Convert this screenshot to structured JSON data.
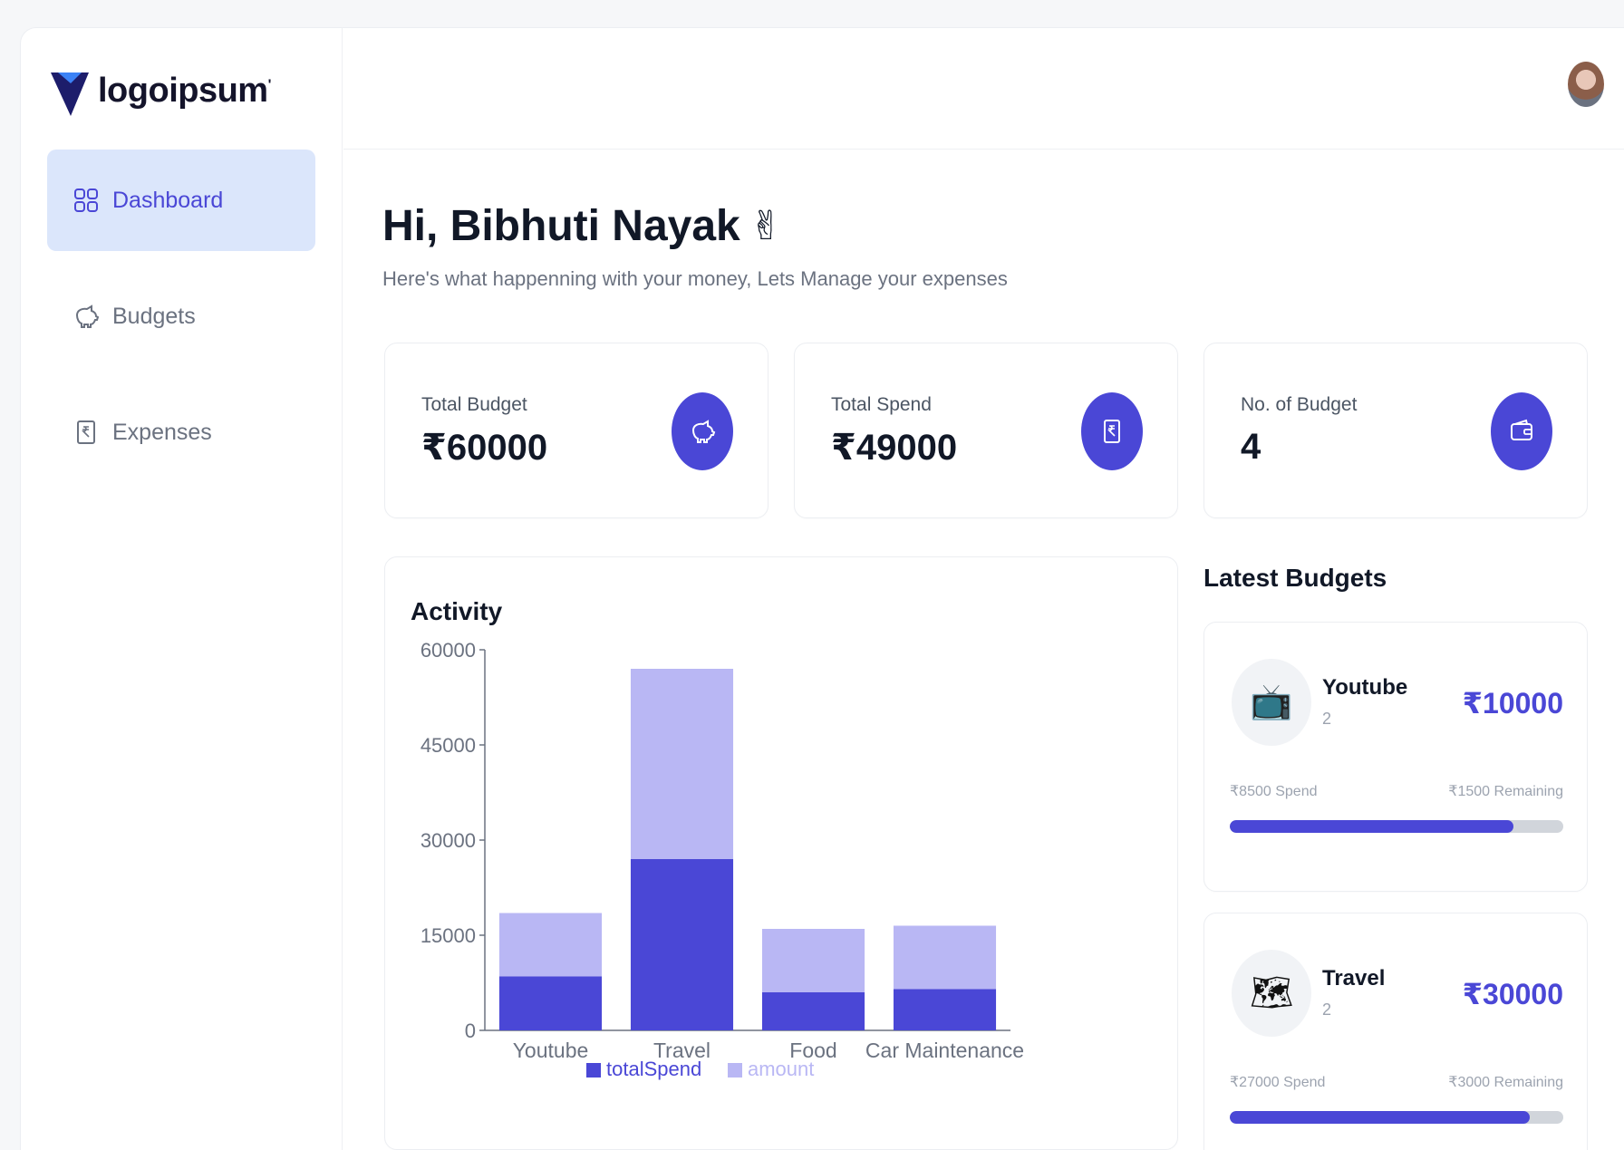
{
  "brand": {
    "name": "logoipsum",
    "mark": "'"
  },
  "sidebar": {
    "items": [
      {
        "label": "Dashboard",
        "icon": "grid-icon",
        "active": true
      },
      {
        "label": "Budgets",
        "icon": "piggy-bank-icon",
        "active": false
      },
      {
        "label": "Expenses",
        "icon": "receipt-icon",
        "active": false
      }
    ]
  },
  "greeting": {
    "title": "Hi, Bibhuti Nayak",
    "emoji": "✌",
    "subtitle": "Here's what happenning with your money, Lets Manage your expenses"
  },
  "stats": [
    {
      "label": "Total Budget",
      "value": "₹60000",
      "icon": "piggy-bank-icon"
    },
    {
      "label": "Total Spend",
      "value": "₹49000",
      "icon": "receipt-icon"
    },
    {
      "label": "No. of Budget",
      "value": "4",
      "icon": "wallet-icon"
    }
  ],
  "activity": {
    "title": "Activity"
  },
  "chart_data": {
    "type": "bar",
    "stacked": true,
    "categories": [
      "Youtube",
      "Travel",
      "Food",
      "Car Maintenance"
    ],
    "series": [
      {
        "name": "totalSpend",
        "values": [
          8500,
          27000,
          6000,
          6500
        ],
        "color": "#4a47d6"
      },
      {
        "name": "amount",
        "values": [
          10000,
          30000,
          10000,
          10000
        ],
        "color": "#b9b7f4"
      }
    ],
    "yticks": [
      "0",
      "15000",
      "30000",
      "45000",
      "60000"
    ],
    "ylim": [
      0,
      60000
    ],
    "legend": "bottom"
  },
  "latest": {
    "title": "Latest Budgets",
    "budgets": [
      {
        "name": "Youtube",
        "items": "2",
        "amount": "₹10000",
        "spend": "₹8500 Spend",
        "remaining": "₹1500 Remaining",
        "progress": 0.85,
        "icon": "📺"
      },
      {
        "name": "Travel",
        "items": "2",
        "amount": "₹30000",
        "spend": "₹27000 Spend",
        "remaining": "₹3000 Remaining",
        "progress": 0.9,
        "icon": "🗺"
      }
    ]
  }
}
